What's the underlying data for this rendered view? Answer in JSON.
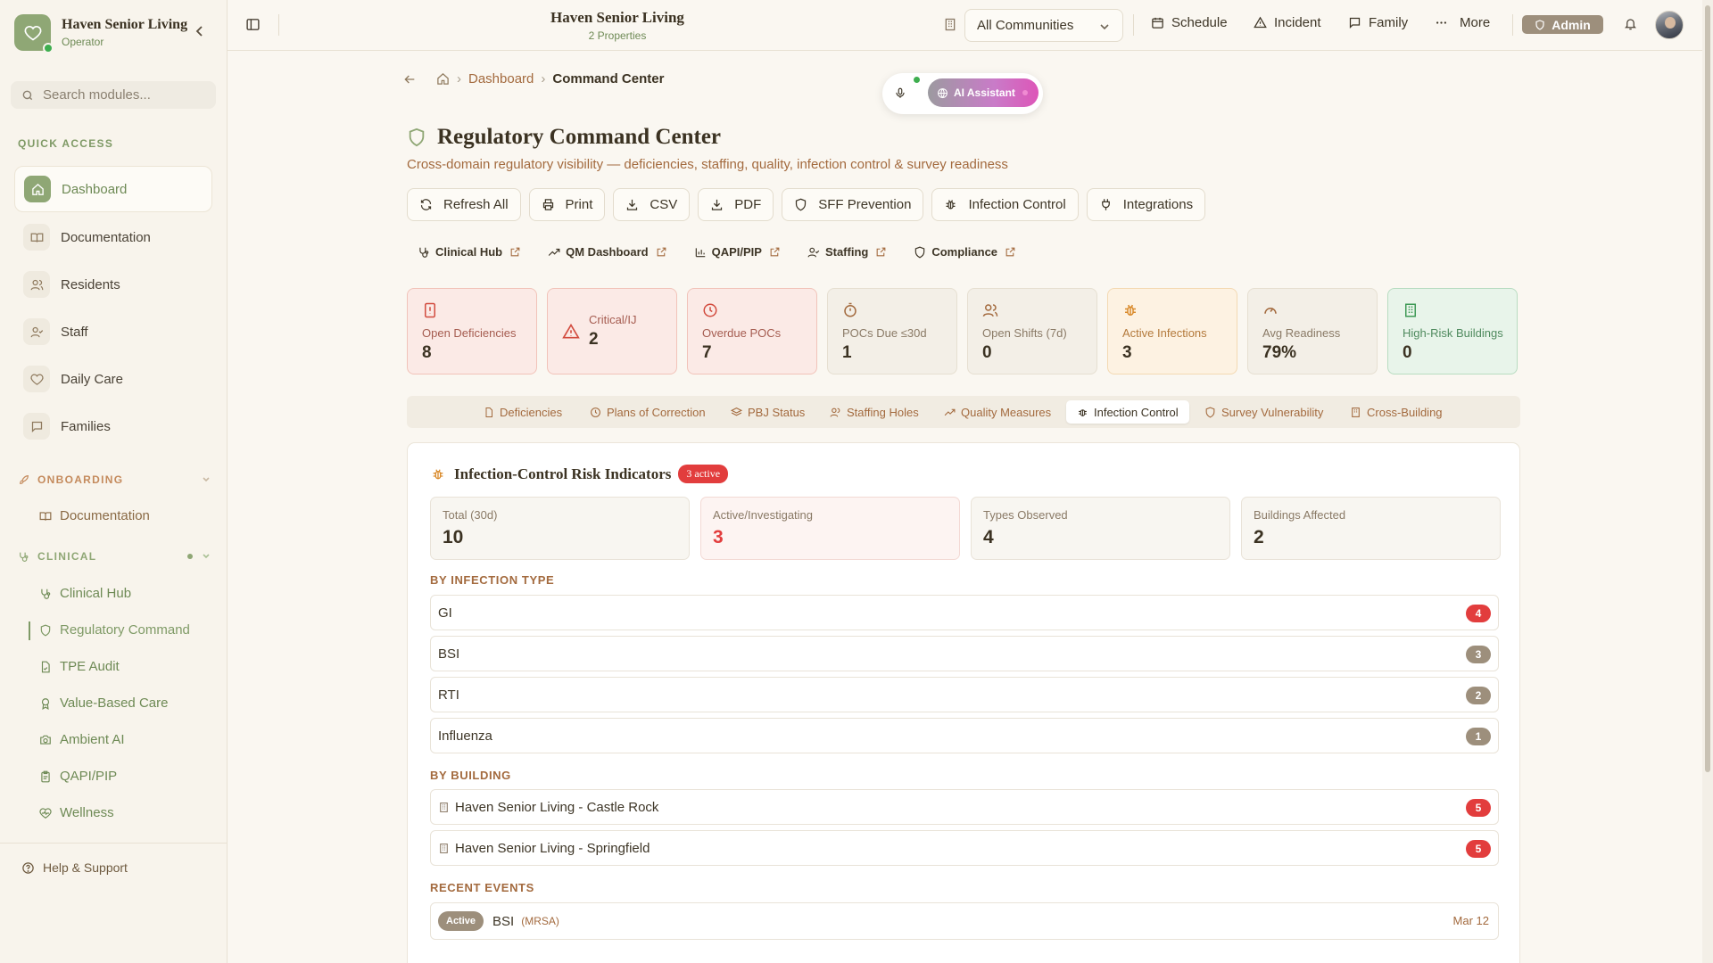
{
  "brand": {
    "name": "Haven Senior Living",
    "role": "Operator"
  },
  "search": {
    "placeholder": "Search modules..."
  },
  "sidebar": {
    "quick_access_label": "QUICK ACCESS",
    "quick_access": [
      {
        "label": "Dashboard",
        "icon": "home-icon",
        "active": true
      },
      {
        "label": "Documentation",
        "icon": "book-icon"
      },
      {
        "label": "Residents",
        "icon": "users-icon"
      },
      {
        "label": "Staff",
        "icon": "user-check-icon"
      },
      {
        "label": "Daily Care",
        "icon": "heart-icon"
      },
      {
        "label": "Families",
        "icon": "message-icon"
      }
    ],
    "onboarding_label": "ONBOARDING",
    "onboarding_items": [
      {
        "label": "Documentation",
        "icon": "book-icon"
      }
    ],
    "clinical_label": "CLINICAL",
    "clinical_items": [
      {
        "label": "Clinical Hub",
        "icon": "stethoscope-icon"
      },
      {
        "label": "Regulatory Command",
        "icon": "shield-icon",
        "active": true
      },
      {
        "label": "TPE Audit",
        "icon": "file-check-icon"
      },
      {
        "label": "Value-Based Care",
        "icon": "award-icon"
      },
      {
        "label": "Ambient AI",
        "icon": "camera-icon"
      },
      {
        "label": "QAPI/PIP",
        "icon": "clipboard-icon"
      },
      {
        "label": "Wellness",
        "icon": "heart-pulse-icon"
      }
    ],
    "help_label": "Help & Support"
  },
  "topbar": {
    "title": "Haven Senior Living",
    "subtitle": "2 Properties",
    "community_select": "All Communities",
    "buttons": {
      "schedule": "Schedule",
      "incident": "Incident",
      "family": "Family",
      "more": "More"
    },
    "admin_label": "Admin"
  },
  "breadcrumb": {
    "dashboard": "Dashboard",
    "current": "Command Center"
  },
  "ai": {
    "label": "AI Assistant"
  },
  "page": {
    "title": "Regulatory Command Center",
    "subtitle": "Cross-domain regulatory visibility — deficiencies, staffing, quality, infection control & survey readiness"
  },
  "actions": [
    "Refresh All",
    "Print",
    "CSV",
    "PDF",
    "SFF Prevention",
    "Infection Control",
    "Integrations"
  ],
  "links": [
    "Clinical Hub",
    "QM Dashboard",
    "QAPI/PIP",
    "Staffing",
    "Compliance"
  ],
  "kpis": [
    {
      "label": "Open Deficiencies",
      "value": "8",
      "tone": "red",
      "icon": "alert-square-icon"
    },
    {
      "label": "Critical/IJ",
      "value": "2",
      "tone": "red",
      "icon": "warning-icon"
    },
    {
      "label": "Overdue POCs",
      "value": "7",
      "tone": "red",
      "icon": "clock-icon"
    },
    {
      "label": "POCs Due ≤30d",
      "value": "1",
      "tone": "neutral",
      "icon": "timer-icon"
    },
    {
      "label": "Open Shifts (7d)",
      "value": "0",
      "tone": "neutral",
      "icon": "users-icon"
    },
    {
      "label": "Active Infections",
      "value": "3",
      "tone": "amber",
      "icon": "bug-icon"
    },
    {
      "label": "Avg Readiness",
      "value": "79%",
      "tone": "neutral",
      "icon": "gauge-icon"
    },
    {
      "label": "High-Risk Buildings",
      "value": "0",
      "tone": "green",
      "icon": "building-icon"
    }
  ],
  "tabs": [
    "Deficiencies",
    "Plans of Correction",
    "PBJ Status",
    "Staffing Holes",
    "Quality Measures",
    "Infection Control",
    "Survey Vulnerability",
    "Cross-Building"
  ],
  "active_tab": "Infection Control",
  "infection": {
    "title": "Infection-Control Risk Indicators",
    "badge": "3 active",
    "stats": [
      {
        "label": "Total (30d)",
        "value": "10"
      },
      {
        "label": "Active/Investigating",
        "value": "3"
      },
      {
        "label": "Types Observed",
        "value": "4"
      },
      {
        "label": "Buildings Affected",
        "value": "2"
      }
    ],
    "by_type_label": "BY INFECTION TYPE",
    "by_type": [
      {
        "name": "GI",
        "count": "4"
      },
      {
        "name": "BSI",
        "count": "3"
      },
      {
        "name": "RTI",
        "count": "2"
      },
      {
        "name": "Influenza",
        "count": "1"
      }
    ],
    "by_building_label": "BY BUILDING",
    "by_building": [
      {
        "name": "Haven Senior Living - Castle Rock",
        "count": "5"
      },
      {
        "name": "Haven Senior Living - Springfield",
        "count": "5"
      }
    ],
    "recent_label": "RECENT EVENTS",
    "recent": [
      {
        "status": "Active",
        "name": "BSI",
        "detail": "(MRSA)",
        "date": "Mar 12"
      }
    ]
  },
  "colors": {
    "accent": "#8fa775",
    "danger": "#e23d3d",
    "brown": "#9d8f7c",
    "link": "#a36a3e"
  }
}
